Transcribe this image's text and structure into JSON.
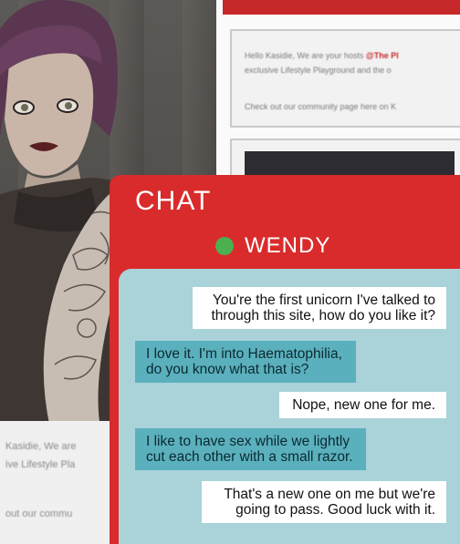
{
  "background": {
    "post_greeting_line1": "Hello Kasidie, We are your hosts",
    "post_greeting_mention": "@The Pl",
    "post_greeting_line2": "exclusive Lifestyle Playground and the o",
    "post_community_line": "Check out our community page here on K",
    "left_panel_line1": "Kasidie, We are",
    "left_panel_line2": "ive Lifestyle Pla",
    "left_panel_line3": "out our commu"
  },
  "chat": {
    "title": "CHAT",
    "contact_name": "WENDY",
    "status_color": "#4caf50",
    "messages": [
      {
        "direction": "outgoing",
        "lines": [
          "You're the first unicorn I've talked to",
          "through this site, how do you like it?"
        ]
      },
      {
        "direction": "incoming",
        "lines": [
          "I love it. I'm into Haematophilia,",
          "do you know what that is?"
        ]
      },
      {
        "direction": "outgoing",
        "lines": [
          "Nope, new one for me."
        ]
      },
      {
        "direction": "incoming",
        "lines": [
          "I like to have sex while we lightly",
          "cut each other with a small razor."
        ]
      },
      {
        "direction": "outgoing",
        "lines": [
          "That's a new one on me but we're",
          "going to pass. Good luck with it."
        ]
      }
    ]
  },
  "colors": {
    "chat_red": "#d92b2b",
    "messages_bg": "#a9d3d9",
    "incoming_bubble": "#5bb0bd",
    "outgoing_bubble": "#ffffff"
  }
}
